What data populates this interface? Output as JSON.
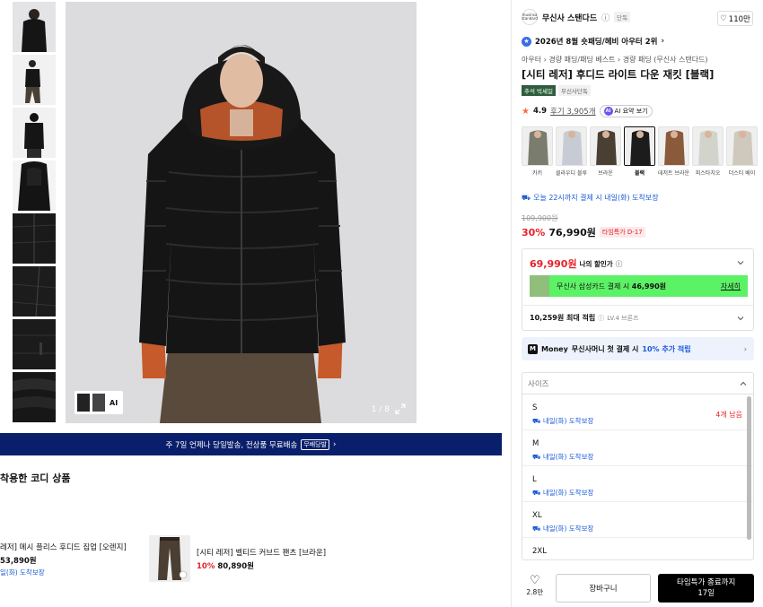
{
  "gallery": {
    "counter": "1 / 8",
    "mini_ai": "AI"
  },
  "banner": {
    "text": "주 7일 언제나 당일발송, 전상품 무료배송",
    "tag": "무배당발",
    "arrow": "›"
  },
  "coordi": {
    "title": "착용한 코디 상품",
    "item1": {
      "name": "레저] 메시 플리스 후디드 집업 [오렌지]",
      "price": "53,890원",
      "delivery": "일(화) 도착보장"
    },
    "item2": {
      "name": "[시티 레저] 벨티드 커브드 팬츠 [브라운]",
      "discount": "10%",
      "price": "80,890원"
    }
  },
  "product": {
    "brand": "무신사 스탠다드",
    "brand_logo_text": "musinsa standard",
    "brand_info": "ⓘ",
    "solo": "단독",
    "likes": "110만",
    "rank": "2026년 8월 숏패딩/헤비 아우터 2위",
    "breadcrumb": [
      "아우터",
      "경량 패딩/패딩 베스트",
      "경량 패딩 (무신사 스탠다드)"
    ],
    "title": "[시티 레저] 후디드 라이트 다운 재킷 [블랙]",
    "badge_sale": "추석 빅세일",
    "badge_solo": "무신사단독",
    "rating": "4.9",
    "reviews": "후기 3,905개",
    "ai_summary": "AI 요약 보기",
    "colors": [
      {
        "name": "카키",
        "color": "#7a7c6e"
      },
      {
        "name": "클라우디 블루",
        "color": "#c7ccd4"
      },
      {
        "name": "브라운",
        "color": "#4a3f33"
      },
      {
        "name": "블랙",
        "color": "#1c1c1c",
        "selected": true
      },
      {
        "name": "데저트 브라운",
        "color": "#8a5a3a"
      },
      {
        "name": "피스타치오",
        "color": "#d2d4cc"
      },
      {
        "name": "더스티 베이",
        "color": "#cfc8bd"
      }
    ],
    "delivery": "오늘 22시까지 결제 시 내일(화) 도착보장",
    "original_price": "109,900원",
    "discount": "30%",
    "price": "76,990원",
    "timer": "타임특가 D-17"
  },
  "benefit": {
    "my_price": "69,990원",
    "my_price_label": "나의 할인가",
    "card_text": "무신사 삼성카드 결제 시",
    "card_price": "46,990원",
    "card_more": "자세히",
    "points": "10,259원 최대 적립",
    "level": "LV.4 브론즈"
  },
  "money": {
    "label": "Money",
    "text": "무신사머니 첫 결제 시",
    "highlight": "10% 추가 적립"
  },
  "size": {
    "placeholder": "사이즈",
    "options": [
      {
        "name": "S",
        "delivery": "내일(화) 도착보장",
        "stock": "4개 남음"
      },
      {
        "name": "M",
        "delivery": "내일(화) 도착보장",
        "stock": ""
      },
      {
        "name": "L",
        "delivery": "내일(화) 도착보장",
        "stock": ""
      },
      {
        "name": "XL",
        "delivery": "내일(화) 도착보장",
        "stock": ""
      },
      {
        "name": "2XL",
        "delivery": "",
        "stock": ""
      }
    ]
  },
  "actions": {
    "like_count": "2.8만",
    "cart": "장바구니",
    "buy_line1": "타임특가 종료까지",
    "buy_line2": "17일"
  }
}
